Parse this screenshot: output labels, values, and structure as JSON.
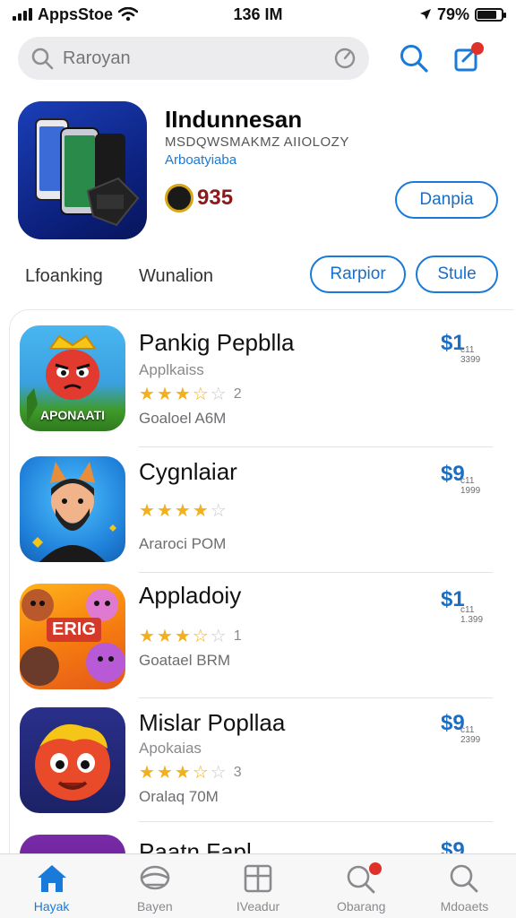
{
  "status_bar": {
    "carrier": "AppsStoe",
    "time": "136 IM",
    "battery": "79%",
    "battery_level": 0.79
  },
  "search": {
    "placeholder": "Raroyan"
  },
  "featured": {
    "title": "IIndunnesan",
    "subtitle": "MSDQWSMAKMZ AIIOLOZY",
    "category": "Arboatyiaba",
    "rating": "935",
    "get_label": "Danpia"
  },
  "filters": {
    "label1": "Lfoanking",
    "label2": "Wunalion",
    "button1": "Rarpior",
    "button2": "Stule"
  },
  "apps": [
    {
      "name": "Pankig Pepblla",
      "category": "Applkaiss",
      "rating": 3.5,
      "rating_count": "2",
      "size": "Goaloel A6M",
      "price": "$1",
      "price_sub": "c11 3399",
      "icon_caption": "APONAATI"
    },
    {
      "name": "Cygnlaiar",
      "category": "",
      "rating": 4,
      "rating_count": "",
      "size": "Araroci POM",
      "price": "$9",
      "price_sub": "c11 1999",
      "icon_caption": ""
    },
    {
      "name": "Appladoiy",
      "category": "",
      "rating": 3.5,
      "rating_count": "1",
      "size": "Goatael BRM",
      "price": "$1",
      "price_sub": "c11 1.399",
      "icon_caption": "ERIG"
    },
    {
      "name": "Mislar Popllaa",
      "category": "Apokaias",
      "rating": 3.5,
      "rating_count": "3",
      "size": "Oralaq 70M",
      "price": "$9",
      "price_sub": "c11 2399",
      "icon_caption": ""
    },
    {
      "name": "Paatn Fapl",
      "category": "",
      "rating": 0,
      "rating_count": "",
      "size": "",
      "price": "$9",
      "price_sub": "",
      "icon_caption": ""
    }
  ],
  "tab_bar": [
    {
      "label": "Hayak",
      "icon": "home-icon",
      "active": true
    },
    {
      "label": "Bayen",
      "icon": "hat-icon",
      "active": false
    },
    {
      "label": "IVeadur",
      "icon": "box-icon",
      "active": false
    },
    {
      "label": "Obarang",
      "icon": "search-badge-icon",
      "active": false
    },
    {
      "label": "Mdoaets",
      "icon": "search-icon",
      "active": false
    }
  ],
  "colors": {
    "accent": "#1a7ad9",
    "star": "#f2b01e",
    "badge": "#e0302a"
  }
}
